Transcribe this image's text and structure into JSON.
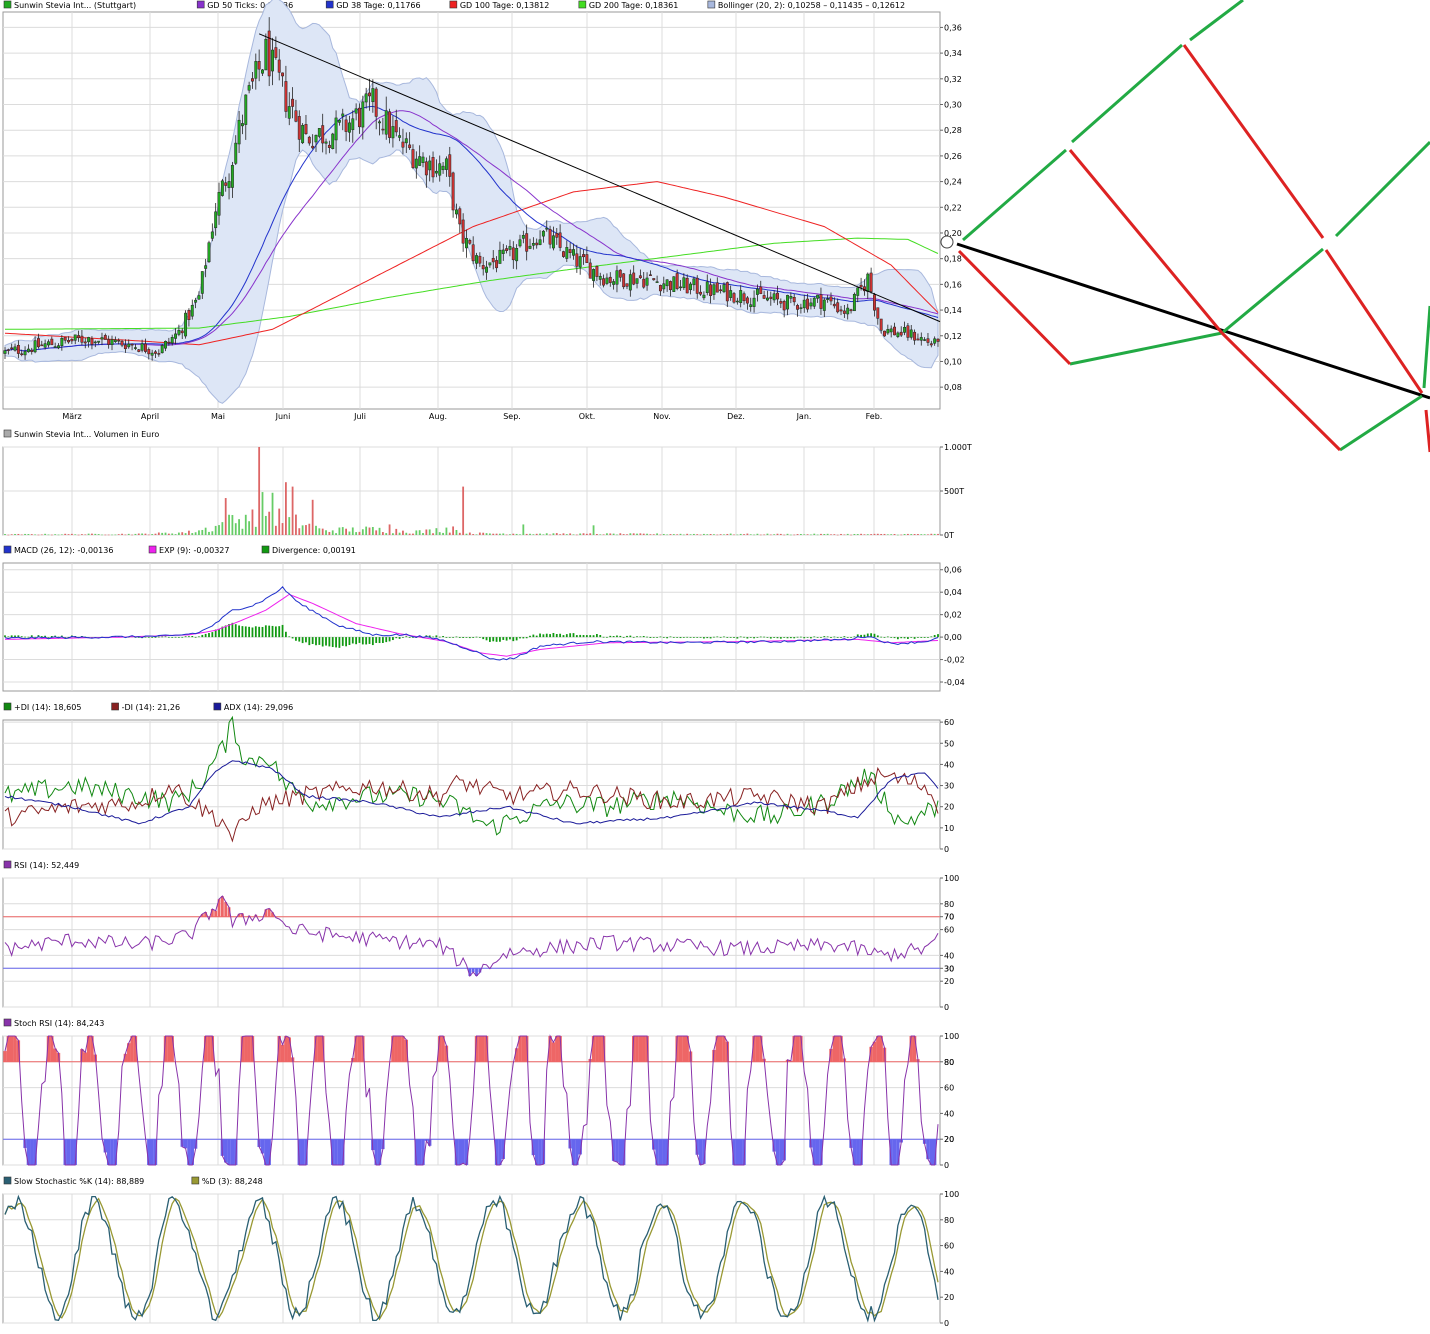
{
  "colors": {
    "grid": "#dcdcdc",
    "frame": "#999999",
    "bull": "#22aa22",
    "bear": "#cc3333",
    "gd50": "#8833cc",
    "gd38": "#2233cc",
    "gd100": "#ee2222",
    "gd200": "#44dd22",
    "boll_fill": "#dde6f6",
    "boll_line": "#a8b8dd",
    "trend": "#000000",
    "macd": "#2233cc",
    "exp": "#ee22ee",
    "div": "#119911",
    "pdi": "#118811",
    "mdi": "#882222",
    "adx": "#1a1a99",
    "rsi": "#8833aa",
    "ob": "#ee6666",
    "os": "#6666ee",
    "stoch_k": "#2a5f73",
    "stoch_d": "#999933",
    "fan_green": "#22aa44",
    "fan_red": "#dd2222"
  },
  "months": [
    "März",
    "April",
    "Mai",
    "Juni",
    "Juli",
    "Aug.",
    "Sep.",
    "Okt.",
    "Nov.",
    "Dez.",
    "Jan.",
    "Feb."
  ],
  "panels": {
    "price": {
      "legend": [
        {
          "label": "Sunwin Stevia Int... (Stuttgart)",
          "color": "#22aa22"
        },
        {
          "label": "GD 50 Ticks: 0,12336",
          "color": "#8833cc"
        },
        {
          "label": "GD 38 Tage: 0,11766",
          "color": "#2233cc"
        },
        {
          "label": "GD 100 Tage: 0,13812",
          "color": "#ee2222"
        },
        {
          "label": "GD 200 Tage: 0,18361",
          "color": "#44dd22"
        },
        {
          "label": "Bollinger (20, 2): 0,10258 – 0,11435 – 0,12612",
          "color": "#a8b8dd"
        }
      ],
      "ticks": [
        "0,36",
        "0,34",
        "0,32",
        "0,30",
        "0,28",
        "0,26",
        "0,24",
        "0,22",
        "0,20",
        "0,18",
        "0,16",
        "0,14",
        "0,12",
        "0,10",
        "0,08"
      ]
    },
    "volume": {
      "legend": [
        {
          "label": "Sunwin Stevia Int... Volumen in Euro",
          "color": "#aaaaaa"
        }
      ],
      "ticks": [
        "1.000T",
        "500T",
        "0T"
      ]
    },
    "macd": {
      "legend": [
        {
          "label": "MACD (26, 12): -0,00136",
          "color": "#2233cc"
        },
        {
          "label": "EXP (9): -0,00327",
          "color": "#ee22ee"
        },
        {
          "label": "Divergence: 0,00191",
          "color": "#119911"
        }
      ],
      "ticks": [
        "0,06",
        "0,04",
        "0,02",
        "0,00",
        "-0,02",
        "-0,04"
      ]
    },
    "dmi": {
      "legend": [
        {
          "label": "+DI (14): 18,605",
          "color": "#118811"
        },
        {
          "label": "-DI (14): 21,26",
          "color": "#882222"
        },
        {
          "label": "ADX (14): 29,096",
          "color": "#1a1a99"
        }
      ],
      "ticks": [
        "60",
        "50",
        "40",
        "30",
        "20",
        "10",
        "0"
      ]
    },
    "rsi": {
      "legend": [
        {
          "label": "RSI (14): 52,449",
          "color": "#8833aa"
        }
      ],
      "ticks": [
        "100",
        "80",
        "70",
        "60",
        "40",
        "30",
        "20",
        "0"
      ],
      "ob_label": "70",
      "os_label": "30"
    },
    "stochrsi": {
      "legend": [
        {
          "label": "Stoch RSI (14): 84,243",
          "color": "#8833aa"
        }
      ],
      "ticks": [
        "100",
        "80",
        "60",
        "40",
        "20",
        "0"
      ],
      "ob_label": "80",
      "os_label": "20"
    },
    "stoch": {
      "legend": [
        {
          "label": "Slow Stochastic %K (14): 88,889",
          "color": "#2a5f73"
        },
        {
          "label": "%D (3): 88,248",
          "color": "#999933"
        }
      ],
      "ticks": [
        "100",
        "80",
        "60",
        "40",
        "20",
        "0"
      ]
    }
  },
  "chart_data": [
    {
      "type": "line",
      "title": "Sunwin Stevia Int... (Stuttgart)",
      "x": [
        "Feb.",
        "März",
        "April",
        "Mai",
        "Juni",
        "Juli",
        "Aug.",
        "Sep.",
        "Okt.",
        "Nov.",
        "Dez.",
        "Jan.",
        "Feb."
      ],
      "series": [
        {
          "name": "Sunwin Stevia Int... (Stuttgart)",
          "values": [
            0.107,
            0.115,
            0.11,
            0.25,
            0.315,
            0.275,
            0.25,
            0.195,
            0.15,
            0.145,
            0.15,
            0.118,
            0.119
          ]
        },
        {
          "name": "GD 38 Tage: 0,11766",
          "values": [
            0.11,
            0.112,
            0.113,
            0.16,
            0.26,
            0.282,
            0.258,
            0.215,
            0.172,
            0.155,
            0.148,
            0.13,
            0.118
          ]
        },
        {
          "name": "GD 100 Tage: 0,13812",
          "values": [
            0.122,
            0.115,
            0.112,
            0.125,
            0.165,
            0.205,
            0.232,
            0.24,
            0.225,
            0.2,
            0.18,
            0.155,
            0.138
          ]
        },
        {
          "name": "GD 200 Tage: 0,18361",
          "values": [
            0.125,
            0.125,
            0.125,
            0.13,
            0.145,
            0.16,
            0.17,
            0.178,
            0.186,
            0.192,
            0.196,
            0.196,
            0.184
          ]
        }
      ],
      "ylim": [
        0.063,
        0.37
      ]
    },
    {
      "type": "bar",
      "title": "Sunwin Stevia Int... Volumen in Euro",
      "ylim": [
        0,
        1000
      ]
    },
    {
      "type": "line",
      "series": [
        {
          "name": "MACD (26, 12): -0,00136"
        },
        {
          "name": "EXP (9): -0,00327"
        },
        {
          "name": "Divergence: 0,00191"
        }
      ],
      "ylim": [
        -0.04,
        0.06
      ]
    },
    {
      "type": "line",
      "series": [
        {
          "name": "+DI (14): 18,605"
        },
        {
          "name": "-DI (14): 21,26"
        },
        {
          "name": "ADX (14): 29,096"
        }
      ],
      "ylim": [
        0,
        60
      ]
    },
    {
      "type": "line",
      "series": [
        {
          "name": "RSI (14): 52,449"
        }
      ],
      "ylim": [
        0,
        100
      ]
    },
    {
      "type": "line",
      "series": [
        {
          "name": "Stoch RSI (14): 84,243"
        }
      ],
      "ylim": [
        0,
        100
      ]
    },
    {
      "type": "line",
      "series": [
        {
          "name": "Slow Stochastic %K (14): 88,889"
        },
        {
          "name": "%D (3): 88,248"
        }
      ],
      "ylim": [
        0,
        100
      ]
    }
  ]
}
